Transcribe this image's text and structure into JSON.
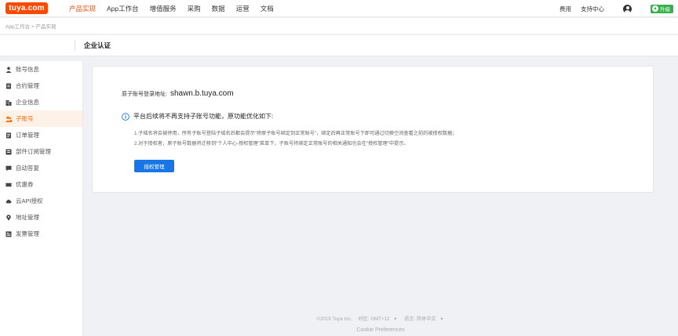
{
  "header": {
    "logo_text": "tuya.com",
    "nav": [
      {
        "label": "产品实现",
        "active": true
      },
      {
        "label": "App工作台",
        "active": false
      },
      {
        "label": "增值服务",
        "active": false
      },
      {
        "label": "采购",
        "active": false
      },
      {
        "label": "数据",
        "active": false
      },
      {
        "label": "运营",
        "active": false
      },
      {
        "label": "文档",
        "active": false
      }
    ],
    "right_links": [
      "费用",
      "支持中心"
    ],
    "upgrade_label": "升级",
    "accent_color": "#ff4800"
  },
  "breadcrumb": "App工作台 > 产品实现",
  "page_title": "企业认证",
  "sidebar": {
    "items": [
      {
        "label": "账号信息",
        "icon": "user-icon",
        "active": false
      },
      {
        "label": "合约管理",
        "icon": "contract-icon",
        "active": false
      },
      {
        "label": "企业信息",
        "icon": "building-icon",
        "active": false
      },
      {
        "label": "子账号",
        "icon": "sub-account-icon",
        "active": true
      },
      {
        "label": "订单管理",
        "icon": "order-icon",
        "active": false
      },
      {
        "label": "部件订阅管理",
        "icon": "subscription-icon",
        "active": false
      },
      {
        "label": "自动答复",
        "icon": "chat-icon",
        "active": false
      },
      {
        "label": "优惠券",
        "icon": "coupon-icon",
        "active": false
      },
      {
        "label": "云API授权",
        "icon": "cloud-icon",
        "active": false
      },
      {
        "label": "地址管理",
        "icon": "location-icon",
        "active": false
      },
      {
        "label": "发票管理",
        "icon": "invoice-icon",
        "active": false
      }
    ]
  },
  "main": {
    "login_label": "原子账号登录地址:",
    "login_value": "shawn.b.tuya.com",
    "notice": "平台后续将不再支持子账号功能，原功能优化如下:",
    "detail_1": "1.子域名将会被停用，所有子账号登陆子域名后都会提示“将原子账号绑定到正常账号”，绑定后再正常账号下即可通过切换空间查看之前的被授权数据；",
    "detail_2": "2.对于授权者，原子账号数据将迁移到“个人中心-授权管理”菜单下，子账号将绑定正常账号的相关通知也会在“授权管理”中提示。",
    "button_label": "授权管理",
    "button_color": "#1876e6"
  },
  "footer": {
    "copyright": "©2019 Tuya Inc.",
    "timezone": "时区: GMT+12",
    "language": "语言: 简体中文",
    "cookie": "Cookie Preferences"
  }
}
